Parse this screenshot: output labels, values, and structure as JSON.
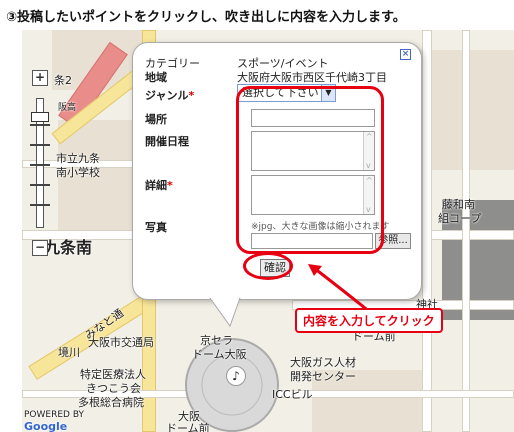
{
  "instruction": "③投稿したいポイントをクリックし、吹き出しに内容を入力します。",
  "map": {
    "labels": {
      "kuranishi": "市立九条",
      "minami_school": "南小学校",
      "kujo_minami": "九条南",
      "traffic": "大阪市交通局",
      "kyocera1": "京セラ",
      "kyocera2": "ドーム大阪",
      "sakaigawa": "境川",
      "medical1": "特定医療法人",
      "medical2": "きつこう会",
      "medical3": "多根総合病院",
      "gas1": "大阪ガス人材",
      "gas2": "開発センター",
      "icc": "ICCビル",
      "dome_mae": "ドーム前",
      "naruo": "藤和南",
      "ko_op": "組コープ",
      "minato": "みなと通",
      "shinto": "神社",
      "osaka1": "大阪",
      "osaka2": "ドーム前",
      "ujo": "条2",
      "hanshin": "阪高",
      "bottom_left": "POWERED BY",
      "google": "Google"
    },
    "zoom": {
      "plus": "+",
      "minus": "−"
    }
  },
  "form": {
    "rows": [
      {
        "label": "カテゴリー",
        "value": "スポーツ/イベント"
      },
      {
        "label": "地域",
        "value": "大阪府大阪市西区千代崎3丁目"
      }
    ],
    "genre": {
      "label": "ジャンル",
      "required": "*",
      "selected": "選択して下さい"
    },
    "place": {
      "label": "場所"
    },
    "date": {
      "label": "開催日程"
    },
    "detail": {
      "label": "詳細",
      "required": "*"
    },
    "photo": {
      "label": "写真",
      "note": "※jpg、大きな画像は縮小されます",
      "browse": "参照..."
    },
    "confirm": "確認",
    "close": "×"
  },
  "callout": "内容を入力してクリック",
  "colors": {
    "accent": "#e60012",
    "road_major": "#f7e59a",
    "road_pink": "#e98d8a"
  }
}
